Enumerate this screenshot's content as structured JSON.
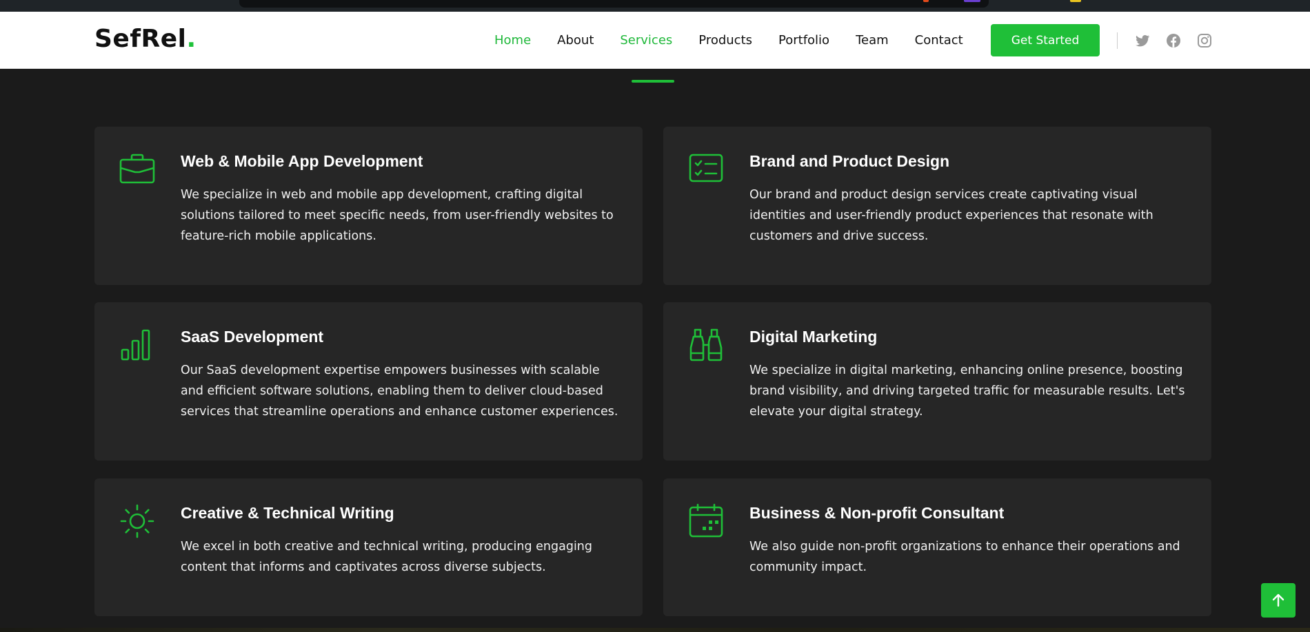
{
  "brand": {
    "name": "SefRel",
    "dot": ".",
    "accent_color": "#1fbf38"
  },
  "nav": {
    "items": [
      {
        "label": "Home",
        "active": true
      },
      {
        "label": "About",
        "active": false
      },
      {
        "label": "Services",
        "active": true
      },
      {
        "label": "Products",
        "active": false
      },
      {
        "label": "Portfolio",
        "active": false
      },
      {
        "label": "Team",
        "active": false
      },
      {
        "label": "Contact",
        "active": false
      }
    ],
    "cta_label": "Get Started",
    "social_icons": [
      "twitter-icon",
      "facebook-icon",
      "instagram-icon"
    ]
  },
  "services": [
    {
      "icon": "briefcase-icon",
      "title": "Web & Mobile App Development",
      "description": "We specialize in web and mobile app development, crafting digital solutions tailored to meet specific needs, from user-friendly websites to feature-rich mobile applications."
    },
    {
      "icon": "checklist-card-icon",
      "title": "Brand and Product Design",
      "description": "Our brand and product design services create captivating visual identities and user-friendly product experiences that resonate with customers and drive success."
    },
    {
      "icon": "bar-chart-icon",
      "title": "SaaS Development",
      "description": "Our SaaS development expertise empowers businesses with scalable and efficient software solutions, enabling them to deliver cloud-based services that streamline operations and enhance customer experiences."
    },
    {
      "icon": "binoculars-icon",
      "title": "Digital Marketing",
      "description": "We specialize in digital marketing, enhancing online presence, boosting brand visibility, and driving targeted traffic for measurable results. Let's elevate your digital strategy."
    },
    {
      "icon": "sun-icon",
      "title": "Creative & Technical Writing",
      "description": "We excel in both creative and technical writing, producing engaging content that informs and captivates across diverse subjects."
    },
    {
      "icon": "calendar-icon",
      "title": "Business & Non-profit Consultant",
      "description": "We also guide non-profit organizations to enhance their operations and community impact."
    }
  ],
  "scroll_top_icon": "arrow-up-icon"
}
